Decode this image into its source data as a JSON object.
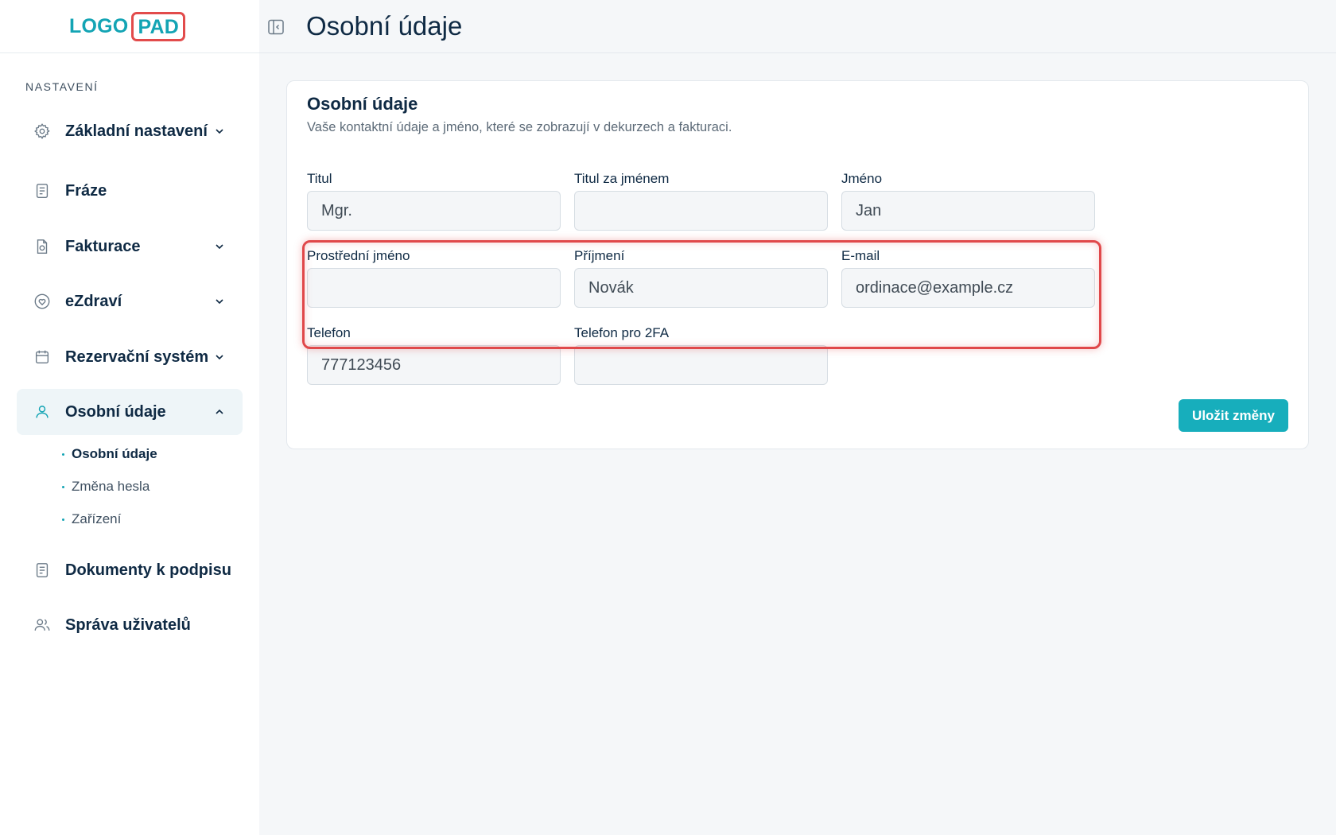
{
  "logo": {
    "part_a": "LOGO",
    "part_b": "PAD"
  },
  "sidebar": {
    "section_label": "NASTAVENÍ",
    "items": [
      {
        "label": "Základní nastavení",
        "icon": "gear-icon",
        "has_chevron": true
      },
      {
        "label": "Fráze",
        "icon": "document-icon",
        "has_chevron": false
      },
      {
        "label": "Fakturace",
        "icon": "invoice-icon",
        "has_chevron": true
      },
      {
        "label": "eZdraví",
        "icon": "heart-icon",
        "has_chevron": true
      },
      {
        "label": "Rezervační systém",
        "icon": "calendar-icon",
        "has_chevron": true
      },
      {
        "label": "Osobní údaje",
        "icon": "user-icon",
        "has_chevron": true,
        "active": true
      },
      {
        "label": "Dokumenty k podpisu",
        "icon": "document-icon",
        "has_chevron": false
      },
      {
        "label": "Správa uživatelů",
        "icon": "users-icon",
        "has_chevron": false
      }
    ],
    "sub_items": [
      {
        "label": "Osobní údaje",
        "active": true
      },
      {
        "label": "Změna hesla",
        "active": false
      },
      {
        "label": "Zařízení",
        "active": false
      }
    ]
  },
  "header": {
    "title": "Osobní údaje"
  },
  "card": {
    "title": "Osobní údaje",
    "description": "Vaše kontaktní údaje a jméno, které se zobrazují v dekurzech a fakturaci.",
    "fields": {
      "titul": {
        "label": "Titul",
        "value": "Mgr."
      },
      "titul_za": {
        "label": "Titul za jménem",
        "value": ""
      },
      "jmeno": {
        "label": "Jméno",
        "value": "Jan"
      },
      "prostredni": {
        "label": "Prostřední jméno",
        "value": ""
      },
      "prijmeni": {
        "label": "Příjmení",
        "value": "Novák"
      },
      "email": {
        "label": "E-mail",
        "value": "ordinace@example.cz"
      },
      "telefon": {
        "label": "Telefon",
        "value": "777123456"
      },
      "telefon_2fa": {
        "label": "Telefon pro 2FA",
        "value": ""
      }
    },
    "save_label": "Uložit změny"
  },
  "colors": {
    "accent": "#17aebc",
    "highlight": "#e0484a",
    "text": "#0f2a44"
  }
}
